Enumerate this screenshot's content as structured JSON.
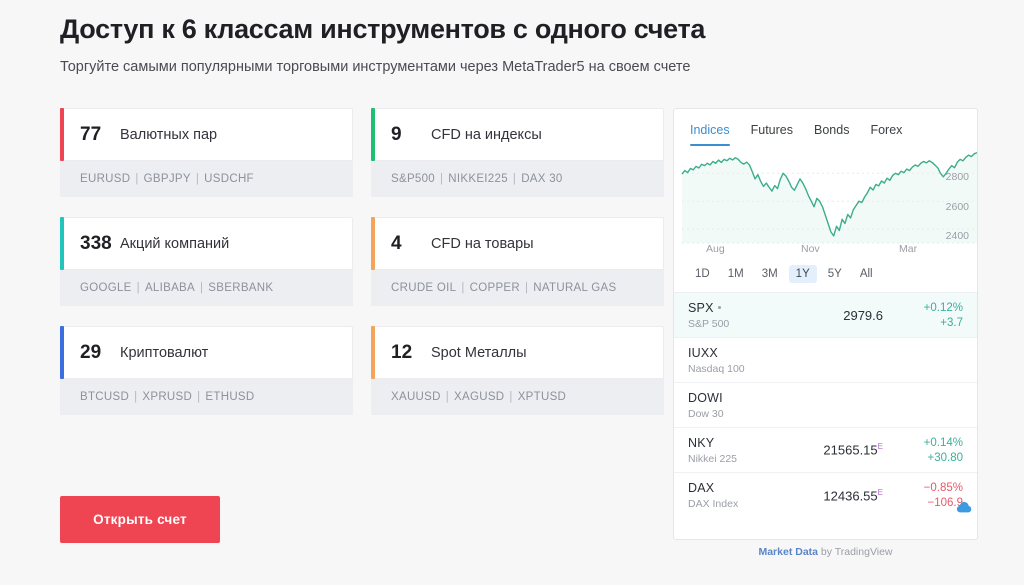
{
  "header": {
    "title": "Доступ к 6 классам инструментов с одного счета",
    "subtitle": "Торгуйте самыми популярными торговыми инструментами через MetaTrader5 на своем счете"
  },
  "cta": {
    "label": "Открыть счет",
    "color": "#ef4452"
  },
  "cards": [
    {
      "count": "77",
      "label": "Валютных пар",
      "color": "#ef4452",
      "symbols": [
        "EURUSD",
        "GBPJPY",
        "USDCHF"
      ]
    },
    {
      "count": "9",
      "label": "CFD на индексы",
      "color": "#1dbf73",
      "symbols": [
        "S&P500",
        "NIKKEI225",
        "DAX 30"
      ]
    },
    {
      "count": "338",
      "label": "Акций компаний",
      "color": "#22c5bb",
      "symbols": [
        "GOOGLE",
        "ALIBABA",
        "SBERBANK"
      ]
    },
    {
      "count": "4",
      "label": "CFD на товары",
      "color": "#f5a55a",
      "symbols": [
        "CRUDE OIL",
        "COPPER",
        "NATURAL GAS"
      ]
    },
    {
      "count": "29",
      "label": "Криптовалют",
      "color": "#3b6fe0",
      "symbols": [
        "BTCUSD",
        "XPRUSD",
        "ETHUSD"
      ]
    },
    {
      "count": "12",
      "label": "Spot Металлы",
      "color": "#f5a55a",
      "symbols": [
        "XAUUSD",
        "XAGUSD",
        "XPTUSD"
      ]
    }
  ],
  "widget": {
    "tabs": [
      {
        "label": "Indices",
        "active": true
      },
      {
        "label": "Futures",
        "active": false
      },
      {
        "label": "Bonds",
        "active": false
      },
      {
        "label": "Forex",
        "active": false
      }
    ],
    "ranges": [
      {
        "label": "1D",
        "active": false
      },
      {
        "label": "1M",
        "active": false
      },
      {
        "label": "3M",
        "active": false
      },
      {
        "label": "1Y",
        "active": true
      },
      {
        "label": "5Y",
        "active": false
      },
      {
        "label": "All",
        "active": false
      }
    ],
    "quotes": [
      {
        "symbol": "SPX",
        "name": "S&P 500",
        "price": "2979.6",
        "sup": "",
        "pct": "+0.12%",
        "abs": "+3.7",
        "dir": "up",
        "selected": true,
        "live_dot": true
      },
      {
        "symbol": "IUXX",
        "name": "Nasdaq 100",
        "price": "",
        "sup": "",
        "pct": "",
        "abs": "",
        "dir": "",
        "selected": false,
        "live_dot": false
      },
      {
        "symbol": "DOWI",
        "name": "Dow 30",
        "price": "",
        "sup": "",
        "pct": "",
        "abs": "",
        "dir": "",
        "selected": false,
        "live_dot": false
      },
      {
        "symbol": "NKY",
        "name": "Nikkei 225",
        "price": "21565.15",
        "sup": "E",
        "pct": "+0.14%",
        "abs": "+30.80",
        "dir": "up",
        "selected": false,
        "live_dot": false
      },
      {
        "symbol": "DAX",
        "name": "DAX Index",
        "price": "12436.55",
        "sup": "E",
        "pct": "−0.85%",
        "abs": "−106.9",
        "dir": "down",
        "selected": false,
        "live_dot": false
      }
    ],
    "footer": {
      "link": "Market Data",
      "text": " by TradingView"
    },
    "accent_color": "#3b8ed0"
  },
  "chart_data": {
    "type": "line",
    "title": "",
    "xlabel": "",
    "ylabel": "",
    "series_name": "SPX",
    "line_color": "#3cad8c",
    "fill_color": "#f2faf7",
    "grid": true,
    "ylim": [
      2300,
      2960
    ],
    "yticks": [
      2400,
      2600,
      2800
    ],
    "ytick_labels": [
      "2400",
      "2600",
      "2800"
    ],
    "xtick_labels": [
      "Aug",
      "Nov",
      "Mar"
    ],
    "xtick_positions": [
      0.13,
      0.44,
      0.76
    ],
    "values": [
      2795,
      2820,
      2805,
      2835,
      2825,
      2850,
      2838,
      2865,
      2855,
      2872,
      2860,
      2885,
      2872,
      2895,
      2878,
      2900,
      2890,
      2908,
      2896,
      2912,
      2900,
      2878,
      2866,
      2880,
      2860,
      2812,
      2760,
      2790,
      2742,
      2706,
      2730,
      2700,
      2672,
      2712,
      2690,
      2758,
      2800,
      2780,
      2744,
      2700,
      2678,
      2718,
      2760,
      2730,
      2690,
      2640,
      2600,
      2560,
      2620,
      2600,
      2560,
      2500,
      2440,
      2380,
      2351,
      2420,
      2390,
      2470,
      2440,
      2505,
      2480,
      2540,
      2570,
      2600,
      2590,
      2630,
      2660,
      2700,
      2680,
      2720,
      2710,
      2745,
      2730,
      2765,
      2750,
      2785,
      2800,
      2790,
      2815,
      2805,
      2830,
      2820,
      2845,
      2860,
      2850,
      2872,
      2885,
      2875,
      2890,
      2878,
      2860,
      2840,
      2800,
      2775,
      2800,
      2830,
      2855,
      2840,
      2880,
      2900,
      2890,
      2915,
      2930,
      2920,
      2940,
      2948
    ]
  }
}
